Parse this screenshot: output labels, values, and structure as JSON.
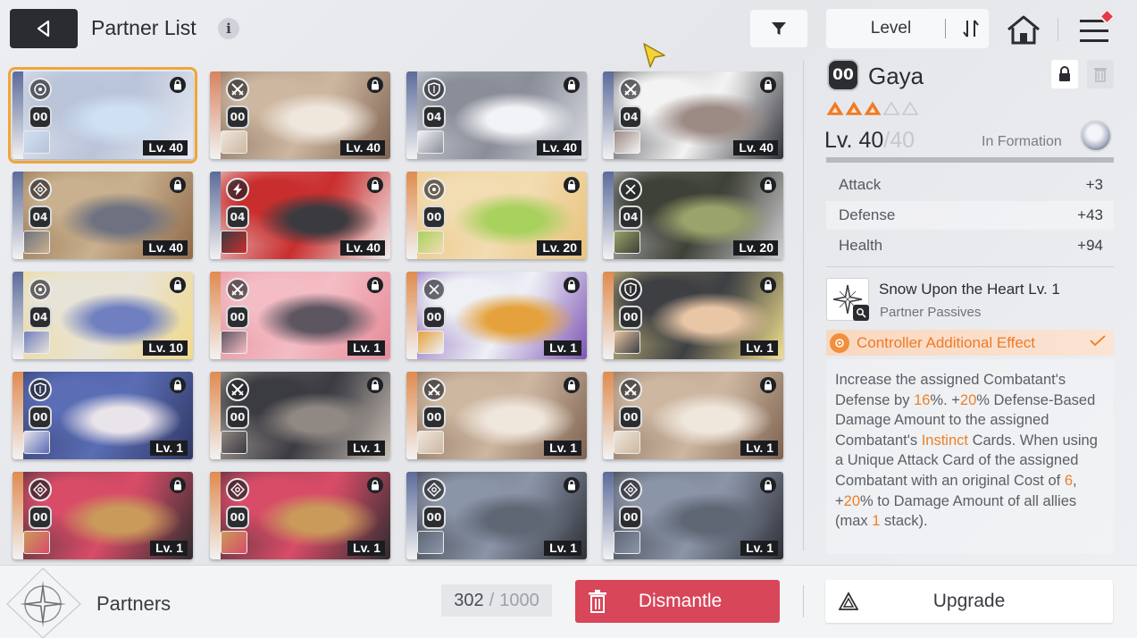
{
  "header": {
    "title": "Partner List",
    "info_icon": "i",
    "sort_label": "Level",
    "icons": [
      "back-arrow-icon",
      "info-icon",
      "filter-icon",
      "sort-toggle-icon",
      "home-icon",
      "menu-icon"
    ]
  },
  "partners": [
    {
      "role": "target",
      "rank": "00",
      "level": "Lv. 40",
      "selected": true,
      "palette": [
        "#5b6b9a",
        "#e7ebf3",
        "#b9c4d9",
        "#cfe0f2"
      ]
    },
    {
      "role": "crossed-swords",
      "rank": "00",
      "level": "Lv. 40",
      "selected": false,
      "palette": [
        "#d9825f",
        "#7d6250",
        "#cdb7a1",
        "#efe6dc"
      ]
    },
    {
      "role": "shield",
      "rank": "04",
      "level": "Lv. 40",
      "selected": false,
      "palette": [
        "#5b6b9a",
        "#d8dbe2",
        "#8a8e99",
        "#f2f3f6"
      ]
    },
    {
      "role": "crossed-swords",
      "rank": "04",
      "level": "Lv. 40",
      "selected": false,
      "palette": [
        "#5b6b9a",
        "#2f3036",
        "#f3f3f3",
        "#9c8a84"
      ]
    },
    {
      "role": "crosshair",
      "rank": "04",
      "level": "Lv. 40",
      "selected": false,
      "palette": [
        "#5b6b9a",
        "#8e6a48",
        "#c9b08e",
        "#6e7280"
      ]
    },
    {
      "role": "lightning",
      "rank": "04",
      "level": "Lv. 40",
      "selected": false,
      "palette": [
        "#5b6b9a",
        "#f1eeee",
        "#c92e2e",
        "#3b3b3f"
      ]
    },
    {
      "role": "target",
      "rank": "00",
      "level": "Lv. 20",
      "selected": false,
      "palette": [
        "#e08b4f",
        "#e9c37d",
        "#f2dcb1",
        "#a8d15d"
      ]
    },
    {
      "role": "crossed-blades",
      "rank": "04",
      "level": "Lv. 20",
      "selected": false,
      "palette": [
        "#5b6b9a",
        "#d0d0d3",
        "#3e4137",
        "#9aa36b"
      ]
    },
    {
      "role": "target",
      "rank": "04",
      "level": "Lv. 10",
      "selected": false,
      "palette": [
        "#5b6b9a",
        "#f1d98a",
        "#e8e3d7",
        "#6f7fbf"
      ]
    },
    {
      "role": "crossed-swords",
      "rank": "00",
      "level": "Lv. 1",
      "selected": false,
      "palette": [
        "#e08b4f",
        "#e58b98",
        "#f4bcc4",
        "#5d5560"
      ]
    },
    {
      "role": "crossed-blades",
      "rank": "00",
      "level": "Lv. 1",
      "selected": false,
      "palette": [
        "#e08b4f",
        "#7f55b5",
        "#eef0f6",
        "#e5a13b"
      ]
    },
    {
      "role": "shield",
      "rank": "00",
      "level": "Lv. 1",
      "selected": false,
      "palette": [
        "#e08b4f",
        "#f2df8d",
        "#3d3f43",
        "#e9c6a5"
      ]
    },
    {
      "role": "shield",
      "rank": "00",
      "level": "Lv. 1",
      "selected": false,
      "palette": [
        "#e08b4f",
        "#2f3763",
        "#5a6db5",
        "#e9e3ea"
      ]
    },
    {
      "role": "crossed-swords",
      "rank": "00",
      "level": "Lv. 1",
      "selected": false,
      "palette": [
        "#e08b4f",
        "#c9bfb4",
        "#3b3b42",
        "#8f8883"
      ]
    },
    {
      "role": "crossed-swords",
      "rank": "00",
      "level": "Lv. 1",
      "selected": false,
      "palette": [
        "#e08b4f",
        "#7d6250",
        "#cdb7a1",
        "#efe6dc"
      ]
    },
    {
      "role": "crossed-swords",
      "rank": "00",
      "level": "Lv. 1",
      "selected": false,
      "palette": [
        "#e08b4f",
        "#7d6250",
        "#cdb7a1",
        "#efe6dc"
      ]
    },
    {
      "role": "crosshair",
      "rank": "00",
      "level": "Lv. 1",
      "selected": false,
      "palette": [
        "#e08b4f",
        "#2c2c2e",
        "#d94c68",
        "#c99a5a"
      ]
    },
    {
      "role": "crosshair",
      "rank": "00",
      "level": "Lv. 1",
      "selected": false,
      "palette": [
        "#e08b4f",
        "#2c2c2e",
        "#d94c68",
        "#c99a5a"
      ]
    },
    {
      "role": "crosshair",
      "rank": "00",
      "level": "Lv. 1",
      "selected": false,
      "palette": [
        "#5b6b9a",
        "#2d2f36",
        "#8b95a8",
        "#5f6775"
      ]
    },
    {
      "role": "crosshair",
      "rank": "00",
      "level": "Lv. 1",
      "selected": false,
      "palette": [
        "#5b6b9a",
        "#2d2f36",
        "#8b95a8",
        "#5f6775"
      ]
    }
  ],
  "detail": {
    "rank": "00",
    "name": "Gaya",
    "stars_filled": 3,
    "stars_total": 5,
    "level": "Lv. 40",
    "level_max": "/40",
    "formation_label": "In Formation",
    "xp_fraction": 1.0,
    "stats": [
      {
        "name": "Attack",
        "value": "+3"
      },
      {
        "name": "Defense",
        "value": "+43"
      },
      {
        "name": "Health",
        "value": "+94"
      }
    ],
    "skill": {
      "name": "Snow Upon the Heart Lv. 1",
      "type": "Partner Passives",
      "icon": "snowflake-star-icon"
    },
    "effect_label": "Controller Additional Effect",
    "description": [
      {
        "t": "Increase the assigned Combatant's Defense by "
      },
      {
        "t": "16",
        "hl": true
      },
      {
        "t": "%. +"
      },
      {
        "t": "20",
        "hl": true
      },
      {
        "t": "% Defense-Based Damage Amount to the assigned Combatant's "
      },
      {
        "t": "Instinct",
        "hl": true
      },
      {
        "t": " Cards. When using a Unique Attack Card of the assigned Combatant with an original Cost of "
      },
      {
        "t": "6",
        "hl": true
      },
      {
        "t": ", +"
      },
      {
        "t": "20",
        "hl": true
      },
      {
        "t": "% to Damage Amount of all allies (max "
      },
      {
        "t": "1",
        "hl": true
      },
      {
        "t": " stack)."
      }
    ]
  },
  "footer": {
    "section_label": "Partners",
    "count": "302",
    "separator": "/",
    "capacity": "1000",
    "dismantle_label": "Dismantle",
    "upgrade_label": "Upgrade"
  },
  "colors": {
    "accent_orange": "#ee8026",
    "dismantle_red": "#d8465a",
    "selected_outline": "#f0a53a",
    "dark": "#2b2c31"
  }
}
